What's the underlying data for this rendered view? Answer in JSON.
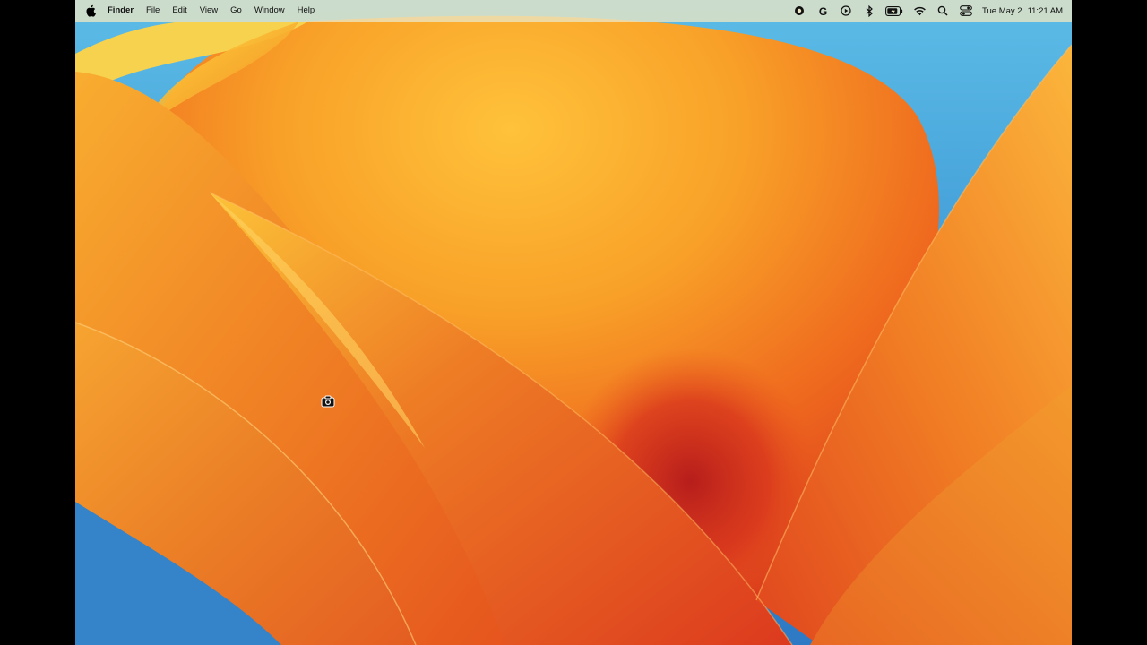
{
  "menubar": {
    "apple_icon": "apple-logo-icon",
    "app_name": "Finder",
    "menus": [
      "File",
      "Edit",
      "View",
      "Go",
      "Window",
      "Help"
    ],
    "status_icons": [
      "record-icon",
      "grammarly-icon",
      "play-icon",
      "bluetooth-icon",
      "battery-icon",
      "wifi-icon",
      "spotlight-search-icon",
      "control-center-icon"
    ],
    "date": "Tue May 2",
    "time": "11:21 AM"
  },
  "desktop": {
    "wallpaper": "macOS Ventura orange wallpaper",
    "cursor": "screenshot-camera-cursor-icon"
  },
  "colors": {
    "sky_blue": "#4aa6de",
    "orange": "#f58a22",
    "yellow": "#ffd84a",
    "red": "#c9271d"
  }
}
